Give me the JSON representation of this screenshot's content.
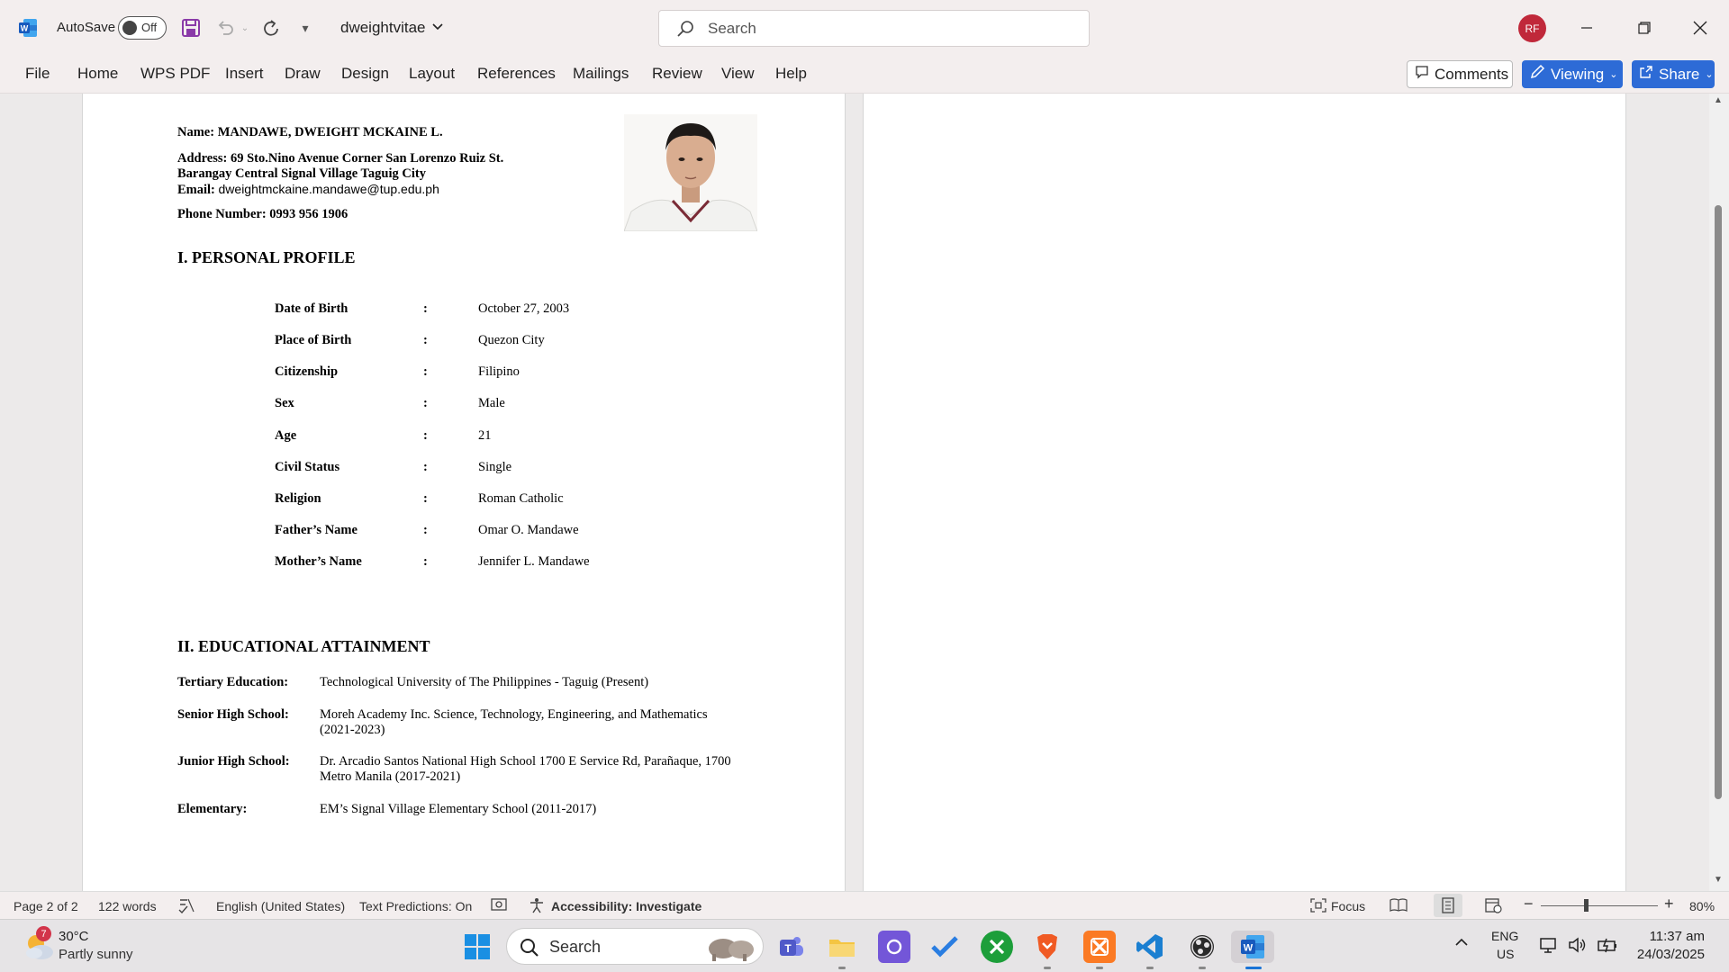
{
  "titlebar": {
    "autosave_label": "AutoSave",
    "autosave_state": "Off",
    "document_name": "dweightvitae",
    "search_placeholder": "Search",
    "user_initials": "RF",
    "accent_color": "#c0283a"
  },
  "ribbon": {
    "tabs": [
      "File",
      "Home",
      "WPS PDF",
      "Insert",
      "Draw",
      "Design",
      "Layout",
      "References",
      "Mailings",
      "Review",
      "View",
      "Help"
    ],
    "comments_label": "Comments",
    "viewing_label": "Viewing",
    "share_label": "Share",
    "button_color": "#2d6bd6"
  },
  "document": {
    "name_line": "Name: MANDAWE, DWEIGHT MCKAINE L.",
    "address_line1": "Address: 69 Sto.Nino Avenue Corner San Lorenzo Ruiz St.",
    "address_line2": "Barangay Central Signal Village Taguig City",
    "email_label": "Email:",
    "email_value": "dweightmckaine.mandawe@tup.edu.ph",
    "phone_line": "Phone Number: 0993 956 1906",
    "section1_title": "I. PERSONAL PROFILE",
    "personal_profile": [
      {
        "label": "Date of Birth",
        "value": "October 27, 2003"
      },
      {
        "label": "Place of Birth",
        "value": "Quezon City"
      },
      {
        "label": "Citizenship",
        "value": "Filipino"
      },
      {
        "label": "Sex",
        "value": "Male"
      },
      {
        "label": "Age",
        "value": "21"
      },
      {
        "label": "Civil Status",
        "value": "Single"
      },
      {
        "label": "Religion",
        "value": "Roman Catholic"
      },
      {
        "label": "Father’s Name",
        "value": "Omar O. Mandawe"
      },
      {
        "label": "Mother’s Name",
        "value": "Jennifer L. Mandawe"
      }
    ],
    "colon": ":",
    "section2_title": "II. EDUCATIONAL ATTAINMENT",
    "education": [
      {
        "label": "Tertiary Education:",
        "value": "Technological University of The Philippines - Taguig  (Present)"
      },
      {
        "label": "Senior High School:",
        "value": "Moreh Academy Inc.  Science, Technology, Engineering, and Mathematics (2021-2023)"
      },
      {
        "label": "Junior High School:",
        "value": "Dr. Arcadio Santos National High School 1700 E Service Rd, Parañaque, 1700 Metro Manila (2017-2021)"
      },
      {
        "label": "Elementary:",
        "value": "EM’s Signal Village Elementary School (2011-2017)"
      }
    ]
  },
  "statusbar": {
    "page": "Page 2 of 2",
    "words": "122 words",
    "language": "English (United States)",
    "text_predictions": "Text Predictions: On",
    "accessibility": "Accessibility: Investigate",
    "focus": "Focus",
    "zoom": "80%"
  },
  "taskbar": {
    "weather_temp": "30°C",
    "weather_desc": "Partly sunny",
    "weather_badge": "7",
    "search_label": "Search",
    "lang_top": "ENG",
    "lang_bottom": "US",
    "time": "11:37 am",
    "date": "24/03/2025"
  }
}
